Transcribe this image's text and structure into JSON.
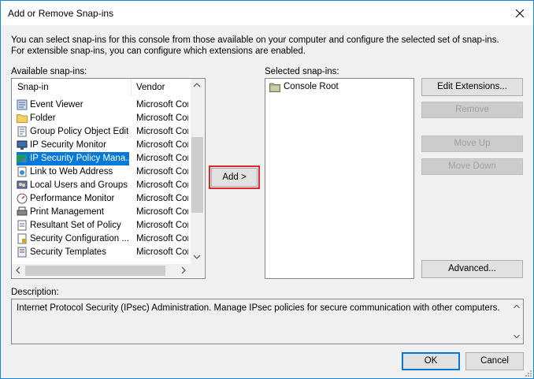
{
  "window": {
    "title": "Add or Remove Snap-ins"
  },
  "intro_text": "You can select snap-ins for this console from those available on your computer and configure the selected set of snap-ins. For extensible snap-ins, you can configure which extensions are enabled.",
  "available": {
    "label": "Available snap-ins:",
    "col_snapin": "Snap-in",
    "col_vendor": "Vendor",
    "rows": [
      {
        "name": "Event Viewer",
        "vendor": "Microsoft Cor...",
        "icon": "event-viewer-icon"
      },
      {
        "name": "Folder",
        "vendor": "Microsoft Cor...",
        "icon": "folder-icon"
      },
      {
        "name": "Group Policy Object Editor",
        "vendor": "Microsoft Cor...",
        "icon": "group-policy-icon"
      },
      {
        "name": "IP Security Monitor",
        "vendor": "Microsoft Cor...",
        "icon": "ip-security-monitor-icon"
      },
      {
        "name": "IP Security Policy Mana...",
        "vendor": "Microsoft Cor...",
        "icon": "ip-security-policy-icon",
        "selected": true
      },
      {
        "name": "Link to Web Address",
        "vendor": "Microsoft Cor...",
        "icon": "web-link-icon"
      },
      {
        "name": "Local Users and Groups",
        "vendor": "Microsoft Cor...",
        "icon": "users-groups-icon"
      },
      {
        "name": "Performance Monitor",
        "vendor": "Microsoft Cor...",
        "icon": "performance-monitor-icon"
      },
      {
        "name": "Print Management",
        "vendor": "Microsoft Cor...",
        "icon": "print-management-icon"
      },
      {
        "name": "Resultant Set of Policy",
        "vendor": "Microsoft Cor...",
        "icon": "resultant-policy-icon"
      },
      {
        "name": "Security Configuration ...",
        "vendor": "Microsoft Cor...",
        "icon": "security-config-icon"
      },
      {
        "name": "Security Templates",
        "vendor": "Microsoft Cor...",
        "icon": "security-templates-icon"
      }
    ]
  },
  "add_button": "Add >",
  "selected": {
    "label": "Selected snap-ins:",
    "root": "Console Root"
  },
  "buttons": {
    "edit_extensions": "Edit Extensions...",
    "remove": "Remove",
    "move_up": "Move Up",
    "move_down": "Move Down",
    "advanced": "Advanced...",
    "ok": "OK",
    "cancel": "Cancel"
  },
  "description": {
    "label": "Description:",
    "text": "Internet Protocol Security (IPsec) Administration. Manage IPsec policies for secure communication with other computers."
  },
  "colors": {
    "accent": "#0078d7",
    "highlight": "#e0282c"
  }
}
